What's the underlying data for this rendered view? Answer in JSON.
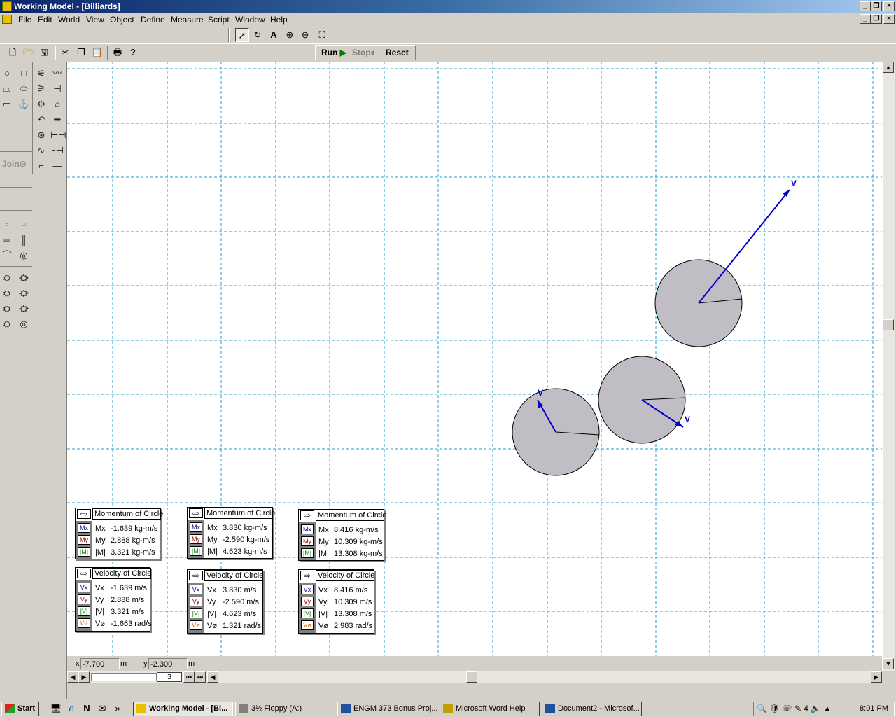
{
  "window": {
    "title": "Working Model - [Billiards]"
  },
  "menu": [
    "File",
    "Edit",
    "World",
    "View",
    "Object",
    "Define",
    "Measure",
    "Script",
    "Window",
    "Help"
  ],
  "run_bar": {
    "run": "Run",
    "stop": "Stop",
    "reset": "Reset"
  },
  "palette": {
    "join": "Join"
  },
  "scene": {
    "vector_label": "V",
    "circle_fill": "#c0bec4",
    "vector_color": "#0000cc",
    "grid_color": "#22a0c8"
  },
  "meters": [
    {
      "momentum": {
        "title": "Momentum of Circle",
        "tags": [
          "Mx",
          "My",
          "|M|"
        ],
        "rows": [
          [
            "Mx",
            "-1.639 kg-m/s"
          ],
          [
            "My",
            "2.888 kg-m/s"
          ],
          [
            "|M|",
            "3.321 kg-m/s"
          ]
        ]
      },
      "velocity": {
        "title": "Velocity of Circle",
        "tags": [
          "Vx",
          "Vy",
          "|V|",
          "Vø"
        ],
        "rows": [
          [
            "Vx",
            "-1.639 m/s"
          ],
          [
            "Vy",
            "2.888 m/s"
          ],
          [
            "|V|",
            "3.321 m/s"
          ],
          [
            "Vø",
            "-1.663 rad/s"
          ]
        ]
      }
    },
    {
      "momentum": {
        "title": "Momentum of Circle",
        "tags": [
          "Mx",
          "My",
          "|M|"
        ],
        "rows": [
          [
            "Mx",
            "3.830 kg-m/s"
          ],
          [
            "My",
            "-2.590 kg-m/s"
          ],
          [
            "|M|",
            "4.623 kg-m/s"
          ]
        ]
      },
      "velocity": {
        "title": "Velocity of Circle",
        "tags": [
          "Vx",
          "Vy",
          "|V|",
          "Vø"
        ],
        "rows": [
          [
            "Vx",
            "3.830 m/s"
          ],
          [
            "Vy",
            "-2.590 m/s"
          ],
          [
            "|V|",
            "4.623 m/s"
          ],
          [
            "Vø",
            "1.321 rad/s"
          ]
        ]
      }
    },
    {
      "momentum": {
        "title": "Momentum of Circle",
        "tags": [
          "Mx",
          "My",
          "|M|"
        ],
        "rows": [
          [
            "Mx",
            "8.416 kg-m/s"
          ],
          [
            "My",
            "10.309 kg-m/s"
          ],
          [
            "|M|",
            "13.308 kg-m/s"
          ]
        ]
      },
      "velocity": {
        "title": "Velocity of Circle",
        "tags": [
          "Vx",
          "Vy",
          "|V|",
          "Vø"
        ],
        "rows": [
          [
            "Vx",
            "8.416 m/s"
          ],
          [
            "Vy",
            "10.309 m/s"
          ],
          [
            "|V|",
            "13.308 m/s"
          ],
          [
            "Vø",
            "2.983 rad/s"
          ]
        ]
      }
    }
  ],
  "coords": {
    "x_label": "x",
    "x_value": "-7.700",
    "x_unit": "m",
    "y_label": "y",
    "y_value": "-2.300",
    "y_unit": "m"
  },
  "frame": {
    "value": "3"
  },
  "taskbar": {
    "start": "Start",
    "tasks": [
      "Working Model - [Bi...",
      "3½ Floppy (A:)",
      "ENGM 373 Bonus Proj...",
      "Microsoft Word Help",
      "Document2 - Microsof..."
    ],
    "clock": "8:01 PM"
  }
}
